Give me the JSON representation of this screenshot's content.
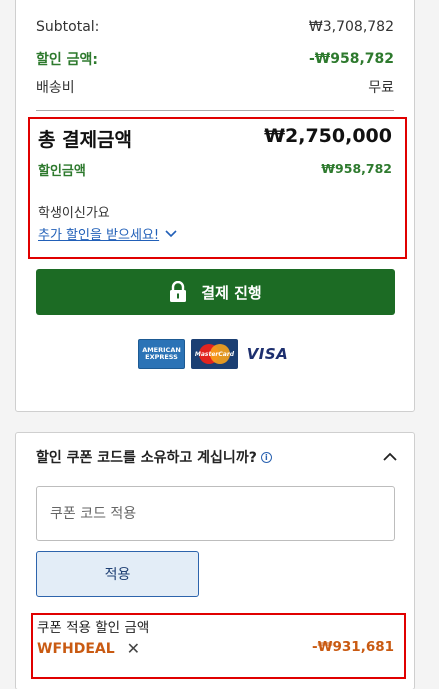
{
  "summary": {
    "subtotal_label": "Subtotal:",
    "subtotal_value": "₩3,708,782",
    "discount_label": "할인 금액:",
    "discount_value": "-₩958,782",
    "shipping_label": "배송비",
    "shipping_value": "무료",
    "total_label": "총 결제금액",
    "total_value": "₩2,750,000",
    "discount2_label": "할인금액",
    "discount2_value": "₩958,782",
    "student_question": "학생이신가요",
    "student_link": "추가 할인을 받으세요!",
    "checkout_label": "결제 진행",
    "payment_methods": [
      {
        "name": "amex-icon",
        "label": "AMERICAN EXPRESS"
      },
      {
        "name": "mastercard-icon",
        "label": "MasterCard"
      },
      {
        "name": "visa-icon",
        "label": "VISA"
      }
    ]
  },
  "coupon": {
    "question": "할인 쿠폰 코드를 소유하고 계십니까?",
    "input_placeholder": "쿠폰 코드 적용",
    "apply_label": "적용",
    "applied_label": "쿠폰 적용 할인 금액",
    "applied_code": "WFHDEAL",
    "applied_amount": "-₩931,681"
  },
  "colors": {
    "green_text": "#2e7a2e",
    "checkout_green": "#1c6b24",
    "coupon_orange": "#c95a12",
    "link_blue": "#2260b8",
    "highlight_red": "#e00000"
  }
}
